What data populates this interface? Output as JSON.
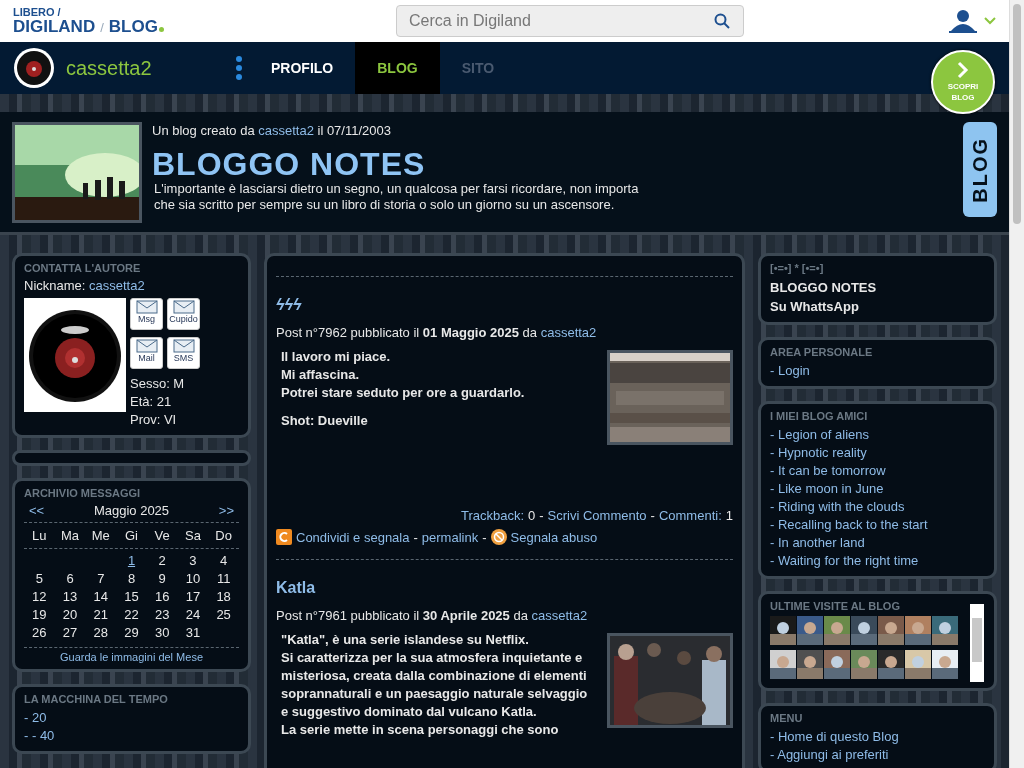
{
  "header": {
    "logo_top": "LIBERO /",
    "logo_main": "DIGILAND",
    "logo_sep": "/",
    "logo_brand": "BLOG",
    "search": {
      "placeholder": "Cerca in Digiland"
    }
  },
  "nav": {
    "user": "cassetta2",
    "tabs": [
      {
        "label": "PROFILO",
        "selected": false,
        "disabled": false
      },
      {
        "label": "BLOG",
        "selected": true,
        "disabled": false
      },
      {
        "label": "SITO",
        "selected": false,
        "disabled": true
      }
    ],
    "discover": "SCOPRI BLOG"
  },
  "banner": {
    "created_prefix": "Un blog creato da",
    "author": "cassetta2",
    "created_suffix": "il 07/11/2003",
    "title": "BLOGGO NOTES",
    "tagline": "L'importante è lasciarsi dietro un segno, un qualcosa per farsi ricordare, non importa che sia scritto per sempre su un libro di storia o solo un giorno su un ascensore.",
    "side_tab": "BLOG"
  },
  "contact": {
    "heading": "CONTATTA L'AUTORE",
    "nickname_label": "Nickname:",
    "nickname": "cassetta2",
    "buttons": [
      "Msg",
      "Cupido",
      "Mail",
      "SMS"
    ],
    "info": [
      "Sesso: M",
      "Età: 21",
      "Prov: VI"
    ]
  },
  "archive": {
    "heading": "ARCHIVIO MESSAGGI",
    "prev": "<<",
    "month": "Maggio 2025",
    "next": ">>",
    "weekdays": [
      "Lu",
      "Ma",
      "Me",
      "Gi",
      "Ve",
      "Sa",
      "Do"
    ],
    "weeks": [
      [
        {
          "kind": "empty"
        },
        {
          "kind": "empty"
        },
        {
          "kind": "empty"
        },
        {
          "kind": "day",
          "day": "1",
          "link": true
        },
        {
          "day": "2",
          "link": false
        },
        {
          "day": "3",
          "link": false
        },
        {
          "day": "4",
          "link": false
        }
      ],
      [
        {
          "day": "5",
          "link": false
        },
        {
          "day": "6",
          "link": false
        },
        {
          "day": "7",
          "link": false
        },
        {
          "day": "8",
          "link": false
        },
        {
          "day": "9",
          "link": false
        },
        {
          "day": "10",
          "link": false
        },
        {
          "day": "11",
          "link": false
        }
      ],
      [
        {
          "day": "12",
          "link": false
        },
        {
          "day": "13",
          "link": false
        },
        {
          "day": "14",
          "link": false
        },
        {
          "day": "15",
          "link": false
        },
        {
          "day": "16",
          "link": false
        },
        {
          "day": "17",
          "link": false
        },
        {
          "day": "18",
          "link": false
        }
      ],
      [
        {
          "day": "19",
          "link": false
        },
        {
          "day": "20",
          "link": false
        },
        {
          "day": "21",
          "link": false
        },
        {
          "day": "22",
          "link": false
        },
        {
          "day": "23",
          "link": false
        },
        {
          "day": "24",
          "link": false
        },
        {
          "day": "25",
          "link": false
        }
      ],
      [
        {
          "day": "26",
          "link": false
        },
        {
          "day": "27",
          "link": false
        },
        {
          "day": "28",
          "link": false
        },
        {
          "day": "29",
          "link": false
        },
        {
          "day": "30",
          "link": false
        },
        {
          "day": "31",
          "link": false
        },
        {
          "kind": "empty"
        }
      ]
    ],
    "footer": "Guarda le immagini del Mese"
  },
  "time_machine": {
    "heading": "LA MACCHINA DEL TEMPO",
    "items": [
      "- 20",
      "- - 40"
    ]
  },
  "posts": [
    {
      "title": "ϟϟϟ",
      "meta": "Post n°7962 pubblicato il **01 Maggio 2025** da",
      "author": "cassetta2",
      "paragraphs": [
        [
          "Il lavoro mi piace.",
          "Mi affascina.",
          "Potrei stare seduto per ore a guardarlo."
        ],
        [
          "Shot: Dueville"
        ]
      ],
      "image": {
        "kind": "picture"
      },
      "footer": {
        "trackback_label": "Trackback:",
        "trackback_count": "0",
        "separator": "-",
        "write_comment": "Scrivi Commento",
        "comments_label": "Commenti:",
        "comments_count": "1"
      },
      "share": {
        "share_label": "Condividi e segnala",
        "permalink": "permalink",
        "report": "Segnala abuso"
      }
    },
    {
      "title": "Katla",
      "meta": "Post n°7961 pubblicato il **30 Aprile 2025** da",
      "author": "cassetta2",
      "paragraphs": [
        [
          "\"Katla\", è una serie islandese su Netflix.",
          "Si caratterizza per la sua atmosfera inquietante e",
          "misteriosa, creata dalla combinazione di elementi",
          "soprannaturali e un paesaggio naturale selvaggio",
          "e suggestivo dominato dal vulcano Katla.",
          "La serie mette in scena personaggi che sono"
        ]
      ],
      "image": {
        "kind": "picture"
      }
    }
  ],
  "right": {
    "whatsapp": {
      "heading": "[•=•] * [•=•]",
      "lines": [
        "BLOGGO NOTES",
        "Su WhattsApp"
      ]
    },
    "personal": {
      "heading": "AREA PERSONALE",
      "items": [
        "- Login"
      ]
    },
    "friends": {
      "heading": "I MIEI BLOG AMICI",
      "items": [
        "- Legion of aliens",
        "- Hypnotic reality",
        "- It can be tomorrow",
        "- Like moon in June",
        "- Riding with the clouds",
        "- Recalling back to the start",
        "- In another land",
        "- Waiting for the right time"
      ]
    },
    "visits": {
      "heading": "ULTIME VISITE AL BLOG",
      "thumbnails": [
        {
          "kind": "picture"
        },
        {
          "kind": "picture"
        },
        {
          "kind": "picture"
        },
        {
          "kind": "picture"
        },
        {
          "kind": "picture"
        },
        {
          "kind": "picture"
        },
        {
          "kind": "picture"
        },
        {
          "kind": "picture"
        },
        {
          "kind": "picture"
        },
        {
          "kind": "picture"
        },
        {
          "kind": "picture"
        },
        {
          "kind": "picture"
        },
        {
          "kind": "picture"
        },
        {
          "kind": "picture"
        }
      ]
    },
    "menu": {
      "heading": "MENU",
      "items": [
        "- Home di questo Blog",
        "- Aggiungi ai preferiti"
      ]
    }
  }
}
